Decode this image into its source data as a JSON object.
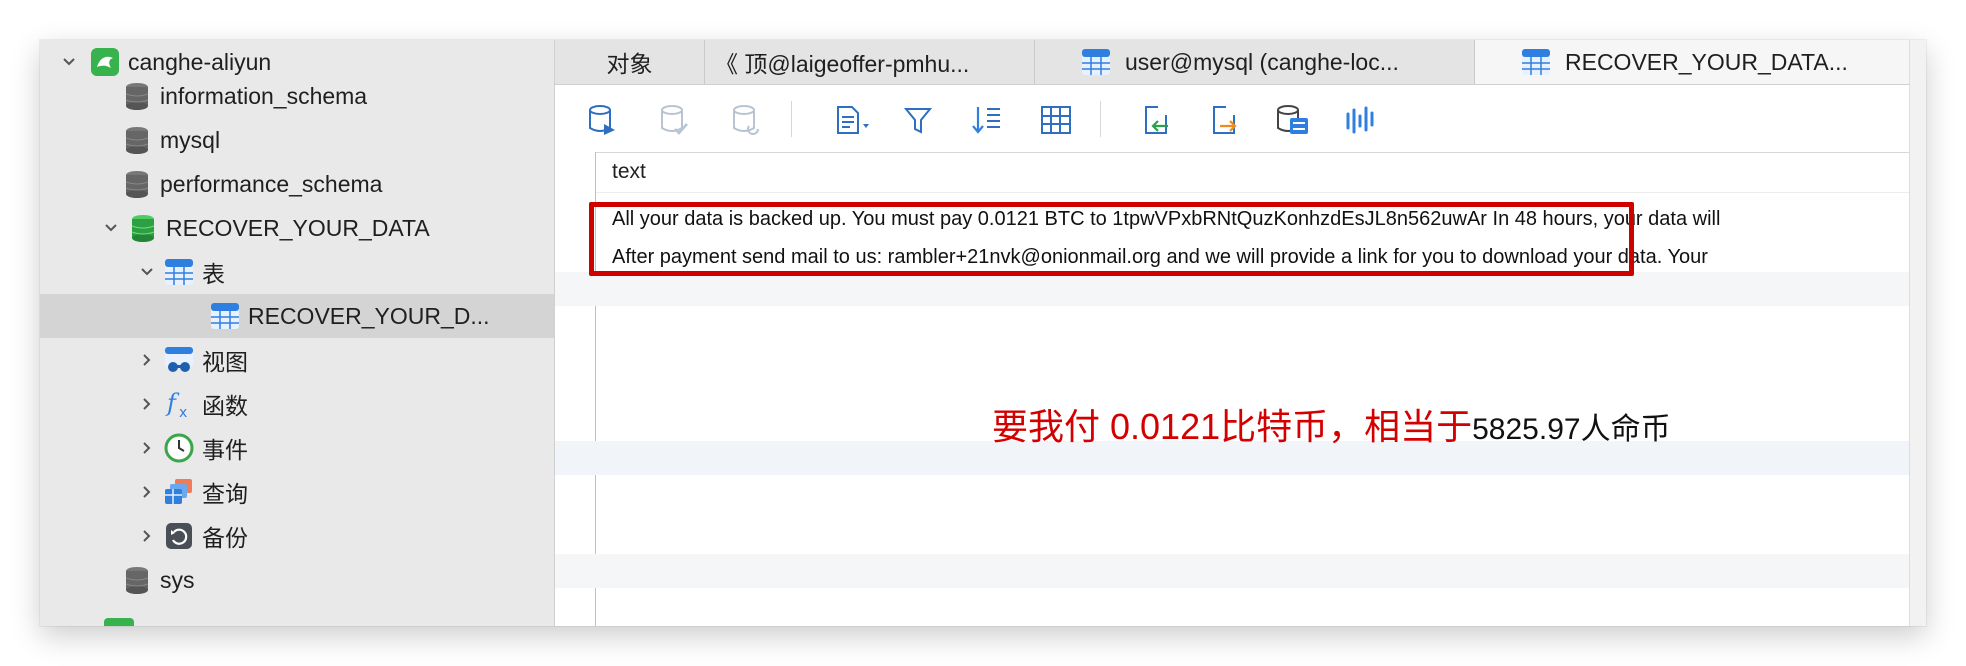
{
  "sidebar": {
    "items": [
      {
        "label": "canghe-aliyun",
        "icon": "mysql-connection-icon"
      },
      {
        "label": "information_schema",
        "icon": "database-icon"
      },
      {
        "label": "mysql",
        "icon": "database-icon"
      },
      {
        "label": "performance_schema",
        "icon": "database-icon"
      },
      {
        "label": "RECOVER_YOUR_DATA",
        "icon": "database-open-icon"
      },
      {
        "label": "表",
        "icon": "tables-icon"
      },
      {
        "label": "RECOVER_YOUR_D...",
        "icon": "table-icon"
      },
      {
        "label": "视图",
        "icon": "views-icon"
      },
      {
        "label": "函数",
        "icon": "functions-icon"
      },
      {
        "label": "事件",
        "icon": "events-icon"
      },
      {
        "label": "查询",
        "icon": "queries-icon"
      },
      {
        "label": "备份",
        "icon": "backup-icon"
      },
      {
        "label": "sys",
        "icon": "database-icon"
      }
    ]
  },
  "tabs": [
    {
      "label": "对象"
    },
    {
      "label": "《 顶@laigeoffer-pmhu..."
    },
    {
      "label": "user@mysql (canghe-loc..."
    },
    {
      "label": "RECOVER_YOUR_DATA..."
    }
  ],
  "grid": {
    "column": "text",
    "rows": [
      "All your data is backed up. You must pay 0.0121 BTC to 1tpwVPxbRNtQuzKonhzdEsJL8n562uwAr In 48 hours, your data will",
      "After payment send mail to us: rambler+21nvk@onionmail.org and we will provide a link for you to download your data. Your"
    ]
  },
  "annotation": {
    "red_text": "要我付 0.0121比特币，相当于",
    "dark_text": "5825.97人命币"
  },
  "colors": {
    "highlight": "#cf0000",
    "mysql_green": "#37b24d",
    "accent_blue": "#2f7fe0"
  }
}
